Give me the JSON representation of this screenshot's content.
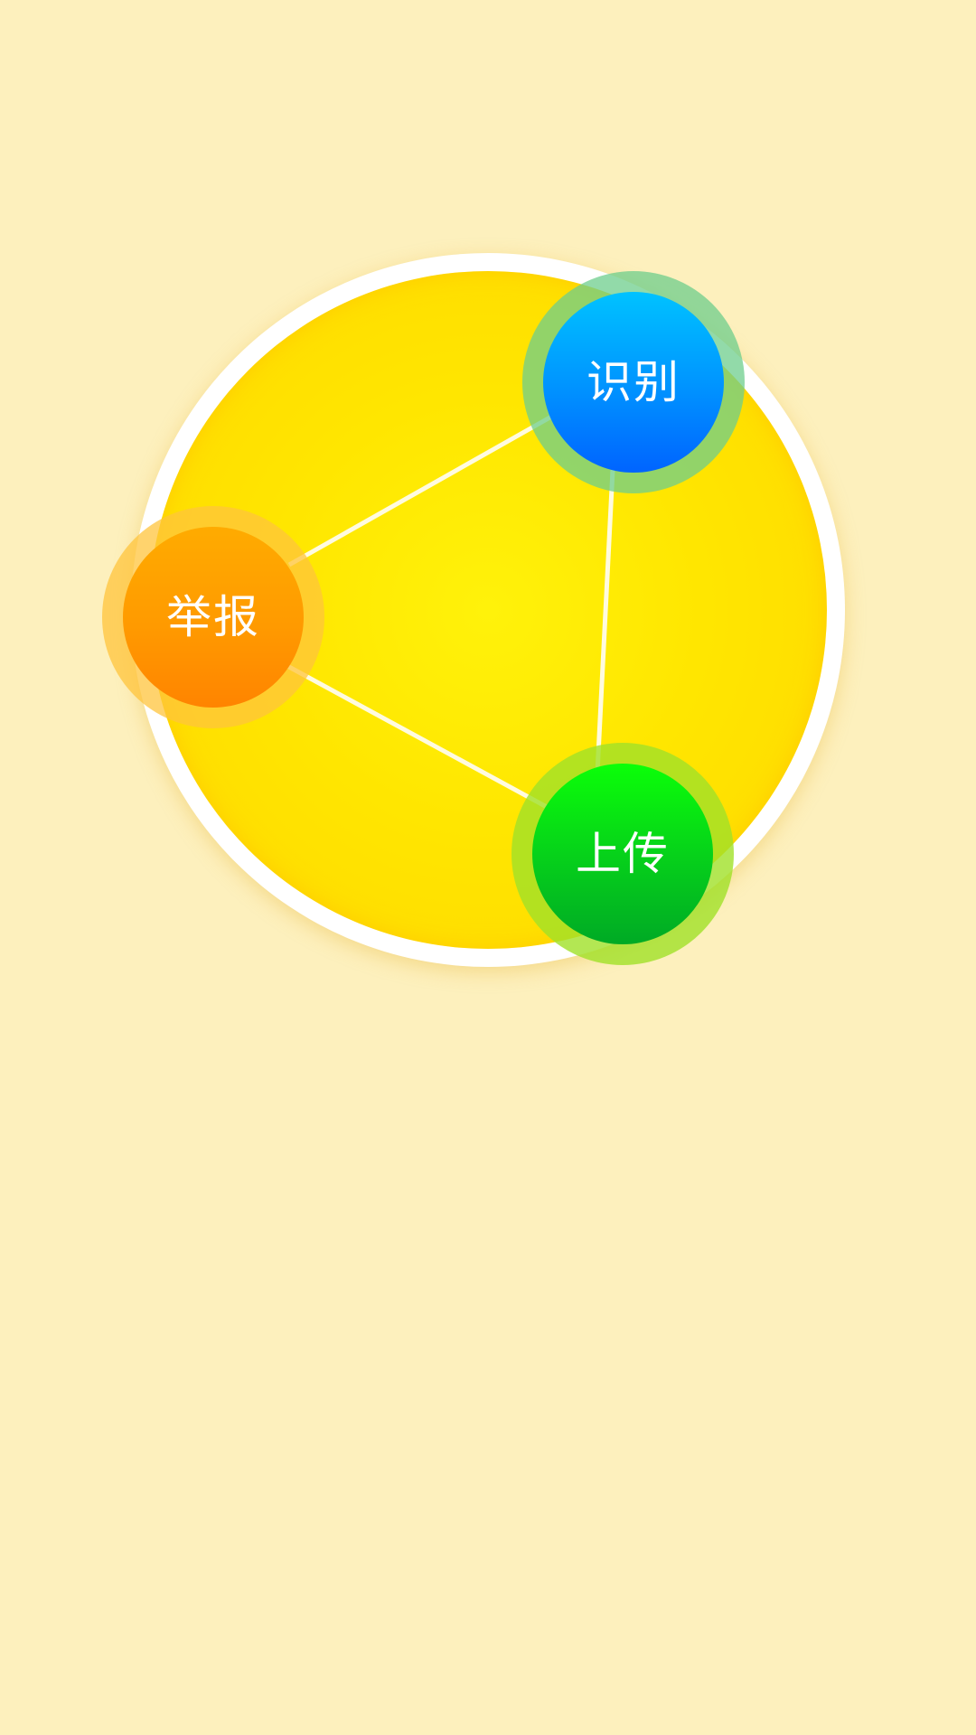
{
  "colors": {
    "background": "#fdf0bd",
    "disc": "#ffe600",
    "disc_ring": "#ffffff",
    "identify": "#0096ff",
    "report": "#ff9a00",
    "upload": "#06d21a",
    "connector": "#fffbe0"
  },
  "actions": {
    "identify": {
      "label": "识别"
    },
    "report": {
      "label": "举报"
    },
    "upload": {
      "label": "上传"
    }
  }
}
